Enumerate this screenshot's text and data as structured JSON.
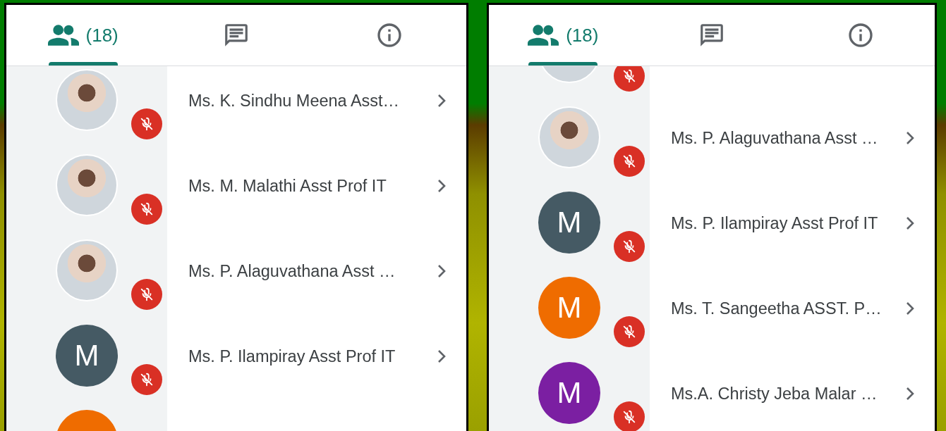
{
  "panels": [
    {
      "tabs": [
        {
          "kind": "people",
          "label": "(18)",
          "selected": true
        },
        {
          "kind": "chat",
          "selected": false
        },
        {
          "kind": "info",
          "selected": false
        }
      ],
      "participants": [
        {
          "kind": "photo",
          "name": "Ms. K. Sindhu Meena Asst…",
          "muted": true
        },
        {
          "kind": "photo",
          "name": "Ms. M. Malathi Asst Prof IT",
          "muted": true
        },
        {
          "kind": "photo",
          "name": "Ms. P. Alaguvathana Asst …",
          "muted": true
        },
        {
          "kind": "letter",
          "letter": "M",
          "color": "#455a64",
          "name": "Ms. P. Ilampiray Asst Prof IT",
          "muted": true
        },
        {
          "kind": "letter",
          "color": "#ef6c00"
        }
      ]
    },
    {
      "tabs": [
        {
          "kind": "people",
          "label": "(18)",
          "selected": true
        },
        {
          "kind": "chat",
          "selected": false
        },
        {
          "kind": "info",
          "selected": false
        }
      ],
      "participants": [
        {
          "kind": "photo",
          "muted": true
        },
        {
          "kind": "photo",
          "name": "Ms. P. Alaguvathana Asst …",
          "muted": true
        },
        {
          "kind": "letter",
          "letter": "M",
          "color": "#455a64",
          "name": "Ms. P. Ilampiray Asst Prof IT",
          "muted": true
        },
        {
          "kind": "letter",
          "letter": "M",
          "color": "#ef6c00",
          "name": "Ms. T. Sangeetha ASST. P…",
          "muted": true
        },
        {
          "kind": "letter",
          "letter": "M",
          "color": "#7b1fa2",
          "name": "Ms.A. Christy Jeba Malar …",
          "muted": true
        }
      ]
    }
  ]
}
